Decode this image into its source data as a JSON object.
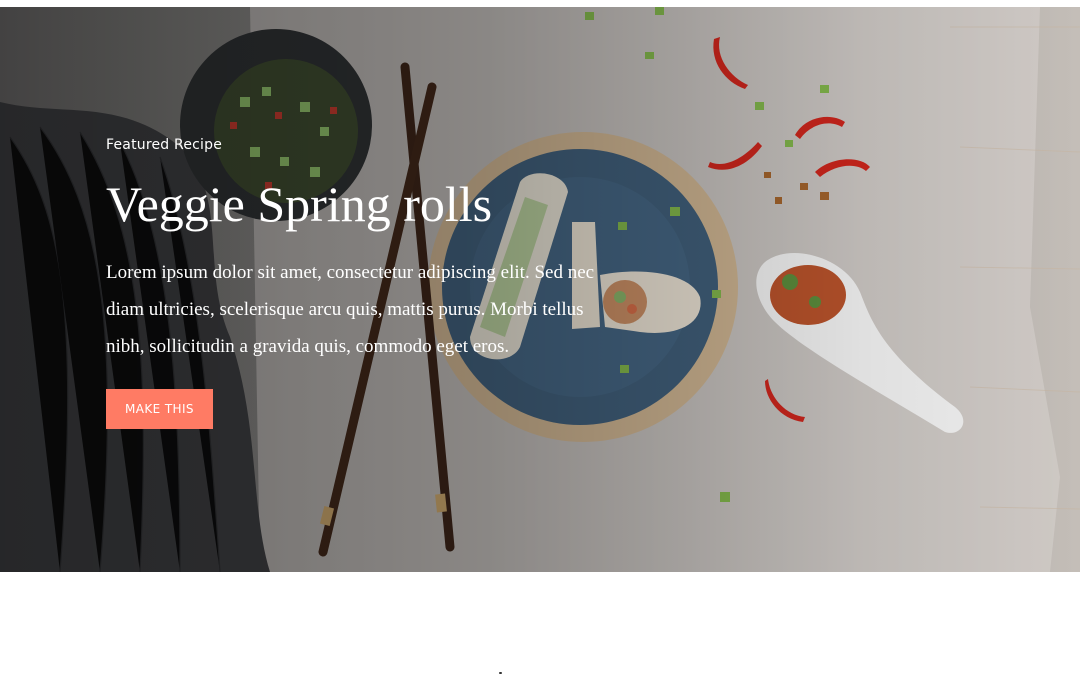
{
  "hero": {
    "eyebrow": "Featured Recipe",
    "title": "Veggie Spring rolls",
    "description": "Lorem ipsum dolor sit amet, consectetur adipiscing elit. Sed nec diam ultricies, scelerisque arcu quis, mattis purus. Morbi tellus nibh, sollicitudin a gravida quis, commodo eget eros.",
    "cta_label": "MAKE THIS",
    "accent_color": "#ff7b64",
    "background_image": "food-photo-spring-rolls"
  }
}
